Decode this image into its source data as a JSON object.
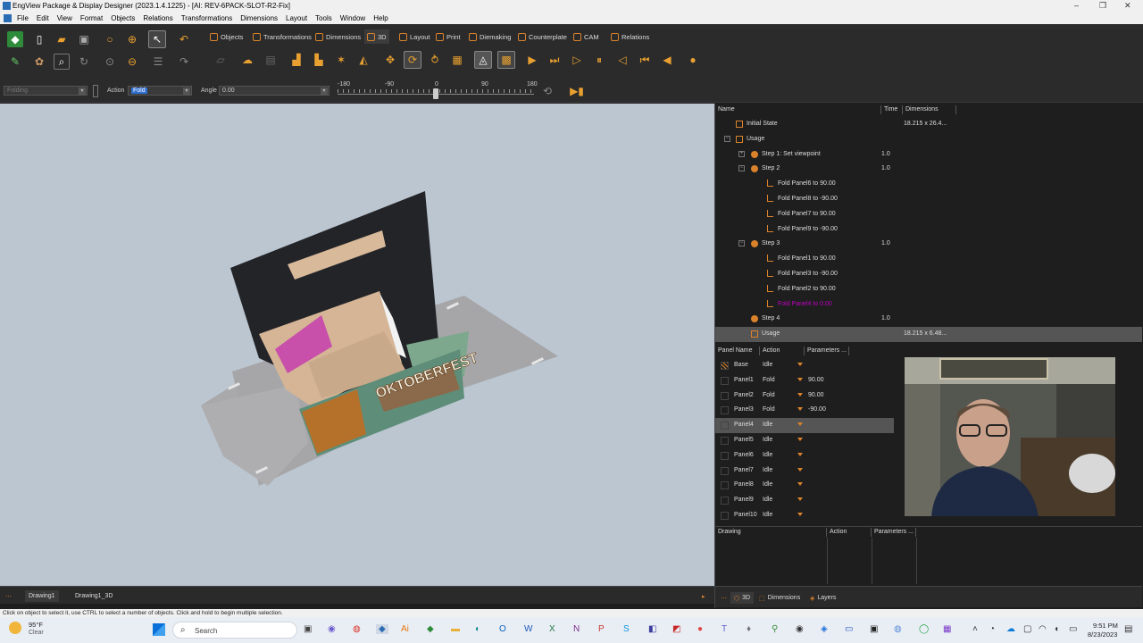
{
  "window": {
    "title": "EngView Package & Display Designer (2023.1.4.1225) - [AI: REV-6PACK-SLOT-R2-Fix]"
  },
  "menu": [
    "File",
    "Edit",
    "View",
    "Format",
    "Objects",
    "Relations",
    "Transformations",
    "Dimensions",
    "Layout",
    "Tools",
    "Window",
    "Help"
  ],
  "tabs": [
    "Objects",
    "Transformations",
    "Dimensions",
    "3D",
    "Layout",
    "Print",
    "Diemaking",
    "Counterplate",
    "CAM",
    "Relations"
  ],
  "action_row": {
    "mode_placeholder": "Folding",
    "action_label": "Action",
    "action_value": "Fold",
    "angle_label": "Angle",
    "angle_value": "0.00",
    "slider_ticks": [
      "-180",
      "-90",
      "0",
      "90",
      "180"
    ],
    "slider_value_deg": 0
  },
  "tree": {
    "headers": [
      "Name",
      "Time",
      "Dimensions"
    ],
    "rows": [
      {
        "name": "Initial State",
        "time": "",
        "dims": "18.215 x 26.4...",
        "type": "box",
        "indent": 0
      },
      {
        "name": "Usage",
        "time": "",
        "dims": "",
        "type": "box",
        "indent": 0,
        "exp": "−"
      },
      {
        "name": "Step 1: Set viewpoint",
        "time": "1.0",
        "dims": "",
        "type": "dot",
        "indent": 1,
        "exp": "+"
      },
      {
        "name": "Step 2",
        "time": "1.0",
        "dims": "",
        "type": "dot",
        "indent": 1,
        "exp": "−"
      },
      {
        "name": "Fold Panel6 to 90.00",
        "time": "",
        "dims": "",
        "type": "l",
        "indent": 2
      },
      {
        "name": "Fold Panel8 to -90.00",
        "time": "",
        "dims": "",
        "type": "l",
        "indent": 2
      },
      {
        "name": "Fold Panel7 to 90.00",
        "time": "",
        "dims": "",
        "type": "l",
        "indent": 2
      },
      {
        "name": "Fold Panel9 to -90.00",
        "time": "",
        "dims": "",
        "type": "l",
        "indent": 2
      },
      {
        "name": "Step 3",
        "time": "1.0",
        "dims": "",
        "type": "dot",
        "indent": 1,
        "exp": "−"
      },
      {
        "name": "Fold Panel1 to 90.00",
        "time": "",
        "dims": "",
        "type": "l",
        "indent": 2
      },
      {
        "name": "Fold Panel3 to -90.00",
        "time": "",
        "dims": "",
        "type": "l",
        "indent": 2
      },
      {
        "name": "Fold Panel2 to 90.00",
        "time": "",
        "dims": "",
        "type": "l",
        "indent": 2
      },
      {
        "name": "Fold Panel4 to 0.00",
        "time": "",
        "dims": "",
        "type": "l",
        "indent": 2,
        "highlight": "#c000c0"
      },
      {
        "name": "Step 4",
        "time": "1.0",
        "dims": "",
        "type": "dot",
        "indent": 1
      },
      {
        "name": "Usage",
        "time": "",
        "dims": "18.215 x 6.48...",
        "type": "box",
        "indent": 1,
        "selected": true
      }
    ]
  },
  "panels": {
    "headers": [
      "Panel Name",
      "Action",
      "Parameters ..."
    ],
    "rows": [
      {
        "name": "Base",
        "action": "Idle",
        "param": "",
        "hatched": true
      },
      {
        "name": "Panel1",
        "action": "Fold",
        "param": "90.00"
      },
      {
        "name": "Panel2",
        "action": "Fold",
        "param": "90.00"
      },
      {
        "name": "Panel3",
        "action": "Fold",
        "param": "-90.00"
      },
      {
        "name": "Panel4",
        "action": "Idle",
        "param": "",
        "selected": true
      },
      {
        "name": "Panel5",
        "action": "Idle",
        "param": ""
      },
      {
        "name": "Panel6",
        "action": "Idle",
        "param": ""
      },
      {
        "name": "Panel7",
        "action": "Idle",
        "param": ""
      },
      {
        "name": "Panel8",
        "action": "Idle",
        "param": ""
      },
      {
        "name": "Panel9",
        "action": "Idle",
        "param": ""
      },
      {
        "name": "Panel10",
        "action": "Idle",
        "param": ""
      }
    ]
  },
  "drawing_table": {
    "headers": [
      "Drawing",
      "Action",
      "Parameters ..."
    ]
  },
  "doc_tabs": [
    "Drawing1",
    "Drawing1_3D"
  ],
  "right_bottom_tabs": [
    "3D",
    "Dimensions",
    "Layers"
  ],
  "status": "Click on object to select it, use CTRL to select a number of objects. Click and hold to begin multiple selection.",
  "weather": {
    "temp": "95°F",
    "cond": "Clear"
  },
  "search_placeholder": "Search",
  "clock": {
    "time": "9:51 PM",
    "date": "8/23/2023"
  },
  "artwork_text": "OKTOBERFEST",
  "colors": {
    "accent": "#d9822b",
    "bg": "#1e1e1e",
    "viewport": "#bcc6d1",
    "selected": "#555555"
  }
}
